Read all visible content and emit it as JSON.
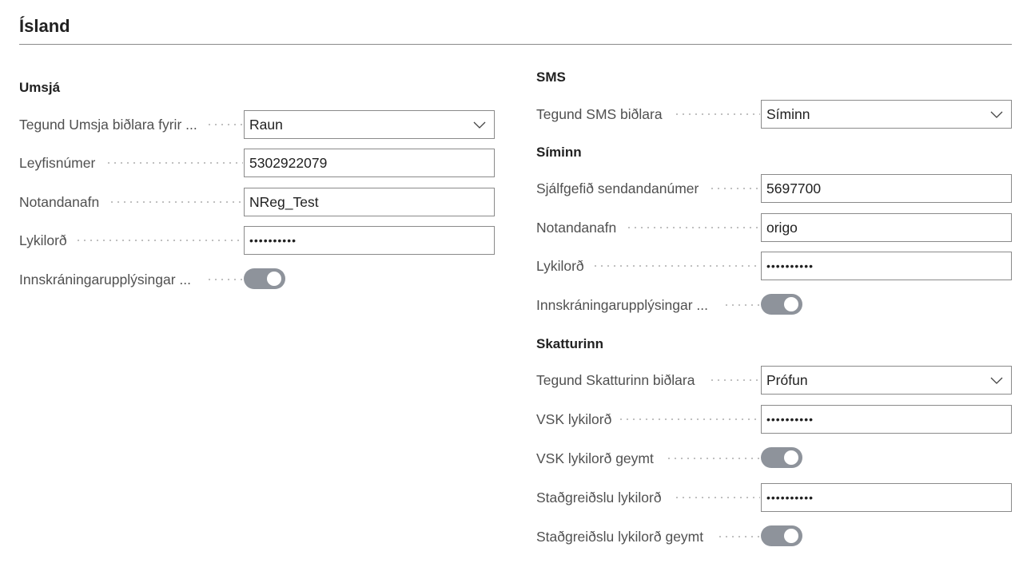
{
  "page": {
    "title": "Ísland"
  },
  "umsja": {
    "title": "Umsjá",
    "fields": {
      "client_type": {
        "label": "Tegund Umsja biðlara fyrir ...",
        "value": "Raun"
      },
      "license": {
        "label": "Leyfisnúmer",
        "value": "5302922079"
      },
      "username": {
        "label": "Notandanafn",
        "value": "NReg_Test"
      },
      "password": {
        "label": "Lykilorð",
        "value": "••••••••••"
      },
      "credentials": {
        "label": "Innskráningarupplýsingar ...",
        "on": true
      }
    }
  },
  "sms": {
    "title": "SMS",
    "client_type": {
      "label": "Tegund SMS biðlara",
      "value": "Síminn"
    }
  },
  "siminn": {
    "title": "Síminn",
    "fields": {
      "sender": {
        "label": "Sjálfgefið sendandanúmer",
        "value": "5697700"
      },
      "username": {
        "label": "Notandanafn",
        "value": "origo"
      },
      "password": {
        "label": "Lykilorð",
        "value": "••••••••••"
      },
      "credentials": {
        "label": "Innskráningarupplýsingar ...",
        "on": true
      }
    }
  },
  "skatturinn": {
    "title": "Skatturinn",
    "fields": {
      "client_type": {
        "label": "Tegund Skatturinn biðlara",
        "value": "Prófun"
      },
      "vsk_password": {
        "label": "VSK lykilorð",
        "value": "••••••••••"
      },
      "vsk_stored": {
        "label": "VSK lykilorð geymt",
        "on": true
      },
      "withholding_password": {
        "label": "Staðgreiðslu lykilorð",
        "value": "••••••••••"
      },
      "withholding_stored": {
        "label": "Staðgreiðslu lykilorð geymt",
        "on": true
      }
    }
  }
}
